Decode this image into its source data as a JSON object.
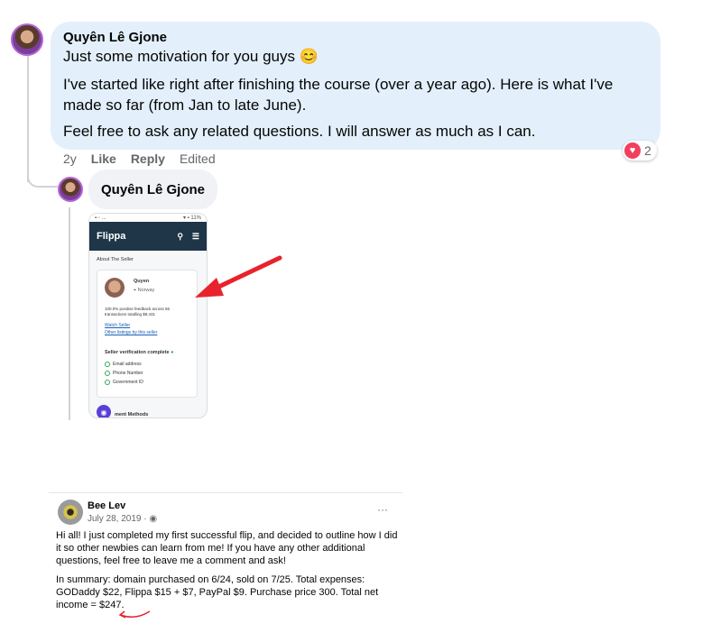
{
  "comment": {
    "author": "Quyên Lê Gjone",
    "lines": [
      "Just some motivation for you guys 😊",
      "I've started like right after finishing the course (over a year ago). Here is what I've made so far (from Jan to late June).",
      "Feel free to ask any related questions. I will answer as much as I can."
    ],
    "age": "2y",
    "like_label": "Like",
    "reply_label": "Reply",
    "edited_label": "Edited",
    "reaction_count": "2"
  },
  "reply": {
    "author": "Quyên Lê Gjone"
  },
  "phone": {
    "app_title": "Flippa",
    "section": "About The Seller",
    "seller_name": "Quyen",
    "seller_location": "Norway",
    "feedback_line1": "100.0% positive feedback across 66",
    "feedback_line2": "transactions totalling $9,431",
    "watch_link": "Watch Seller",
    "other_link": "Other listings by this seller",
    "verification_title": "Seller verification complete",
    "checks": [
      "Email address",
      "Phone Number",
      "Government ID"
    ],
    "payment_label": "ment Methods"
  },
  "post": {
    "author": "Bee Lev",
    "date": "July 28, 2019 · ",
    "more": "···",
    "para1": "Hi all! I just completed my first successful flip, and decided to outline how I did it so other newbies can learn from me! If you have any other additional questions, feel free to leave me a comment and ask!",
    "para2": "In summary: domain purchased on 6/24, sold on 7/25. Total expenses: GODaddy $22, Flippa $15 + $7, PayPal $9. Purchase price 300. Total net income = $247."
  },
  "colors": {
    "bubble": "#e3f0fb",
    "annotation_arrow": "#e8232b",
    "flippa_header": "#1f3548"
  }
}
